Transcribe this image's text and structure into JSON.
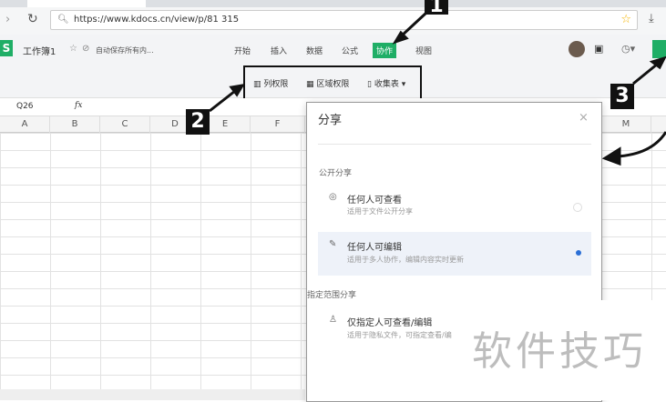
{
  "browser": {
    "url": "https://www.kdocs.cn/view/p/81        315",
    "back_icon": "chevron-left",
    "reload_icon": "reload",
    "star_icon": "star",
    "download_icon": "download"
  },
  "app": {
    "logo": "S",
    "doc_title": "工作簿1",
    "save_status": "自动保存所有内...",
    "menus": [
      "开始",
      "插入",
      "数据",
      "公式",
      "协作",
      "视图"
    ],
    "active_menu": "协作",
    "accent": "#1fae66"
  },
  "toolbar": {
    "items": [
      "列权限",
      "区域权限",
      "收集表"
    ]
  },
  "formula": {
    "cell_ref": "Q26",
    "fx": "fx"
  },
  "columns": [
    "A",
    "B",
    "C",
    "D",
    "E",
    "F",
    "M"
  ],
  "annotations": [
    "1",
    "2",
    "3"
  ],
  "dialog": {
    "title": "分享",
    "close": "×",
    "section_public": "公开分享",
    "options": [
      {
        "title": "任何人可查看",
        "desc": "适用于文件公开分享",
        "selected": false
      },
      {
        "title": "任何人可编辑",
        "desc": "适用于多人协作，编辑内容实时更新",
        "selected": true
      }
    ],
    "section_scoped": "指定范围分享",
    "scoped_option": {
      "title": "仅指定人可查看/编辑",
      "desc": "适用于隐私文件，可指定查看/编"
    }
  },
  "watermark": "软件技巧"
}
